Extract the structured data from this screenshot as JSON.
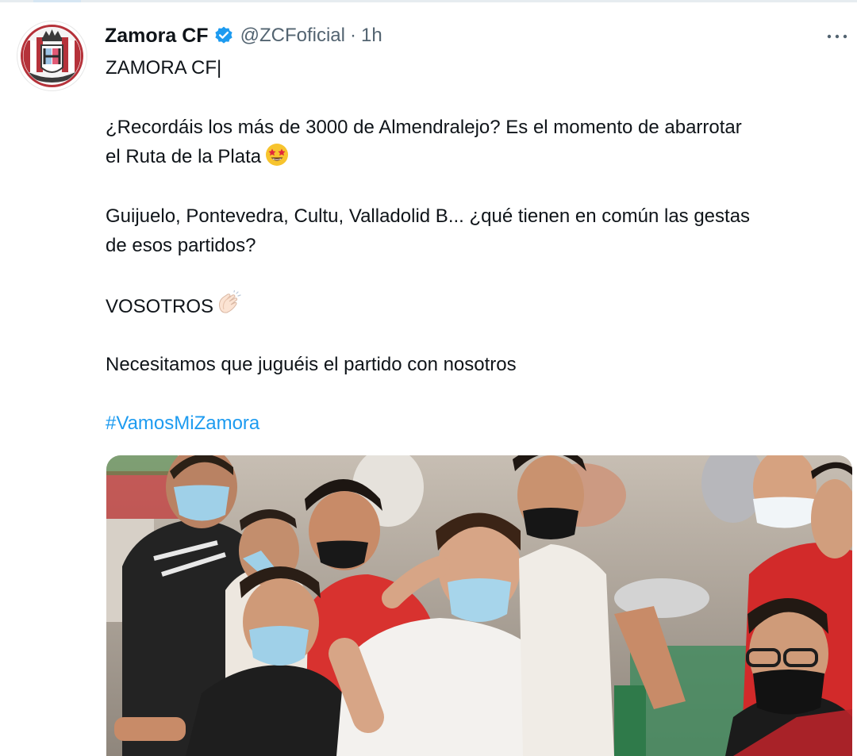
{
  "tweet": {
    "author": {
      "display_name": "Zamora CF",
      "handle": "@ZCFoficial",
      "avatar": "zamora-cf-crest-avatar",
      "verified_icon": "verified-badge-icon"
    },
    "separator": "·",
    "time": "1h",
    "more_icon": "more-options-icon",
    "text": {
      "line1": "ZAMORA CF|",
      "line2": "¿Recordáis los más de 3000 de Almendralejo? Es el momento de abarrotar",
      "line3": "el Ruta de la Plata",
      "line4": "Guijuelo, Pontevedra, Cultu, Valladolid B... ¿qué tienen en común las gestas",
      "line5": "de esos partidos?",
      "line6": "VOSOTROS",
      "line7": "Necesitamos que juguéis el partido con nosotros"
    },
    "hashtag": "#VamosMiZamora",
    "emojis": {
      "star_struck": "star-struck-emoji",
      "clapping": "clapping-hands-emoji"
    },
    "media": {
      "image": "fans-wearing-masks-in-stadium-photo"
    }
  },
  "colors": {
    "text": "#0f1419",
    "secondary": "#536471",
    "link": "#1d9bf0",
    "verified": "#1d9bf0"
  }
}
